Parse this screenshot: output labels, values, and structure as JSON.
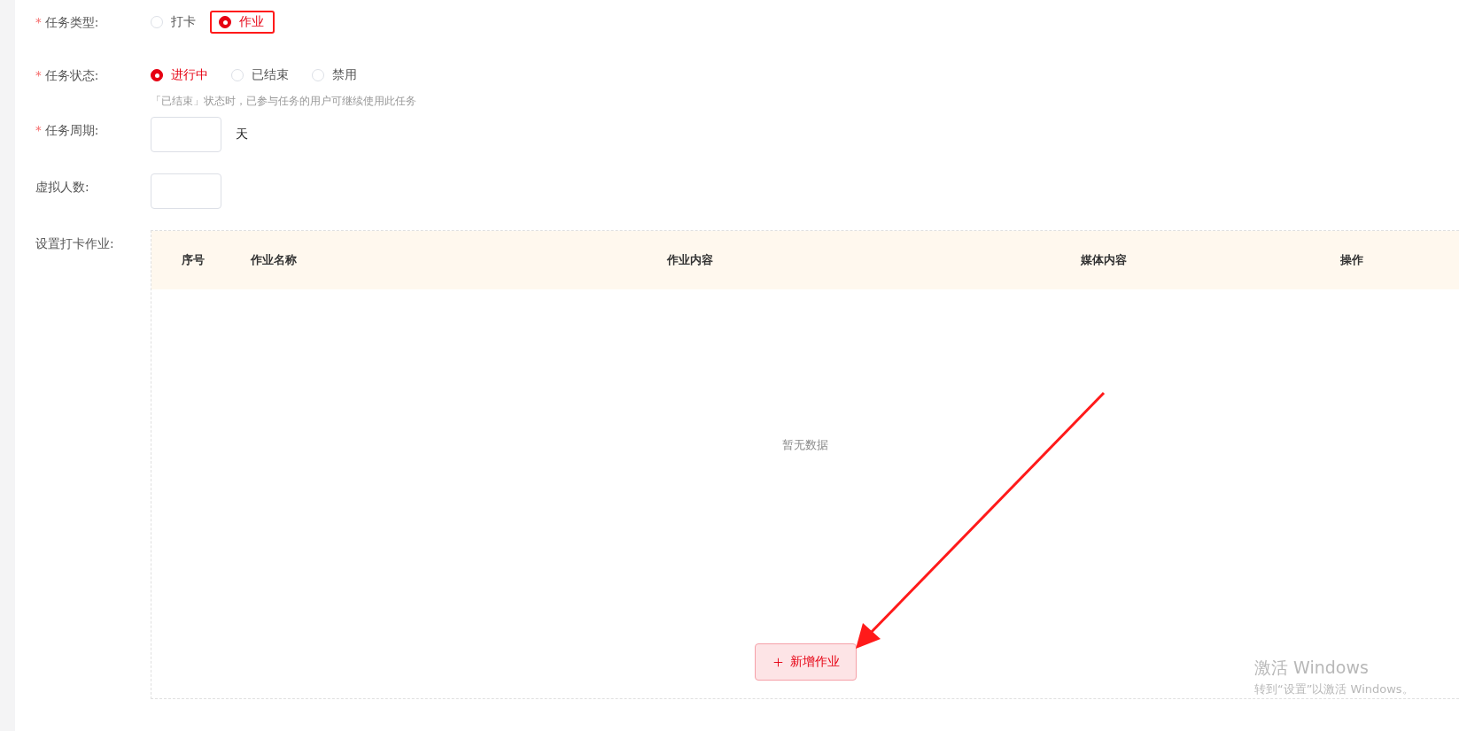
{
  "form": {
    "fields": [
      {
        "kind": "radio",
        "label": "任务类型:",
        "required_mark": "*",
        "options": [
          {
            "label": "打卡",
            "selected": false,
            "highlighted": false
          },
          {
            "label": "作业",
            "selected": true,
            "highlighted": true
          }
        ]
      },
      {
        "kind": "radio",
        "label": "任务状态:",
        "required_mark": "*",
        "options": [
          {
            "label": "进行中",
            "selected": true,
            "highlighted": false
          },
          {
            "label": "已结束",
            "selected": false,
            "highlighted": false
          },
          {
            "label": "禁用",
            "selected": false,
            "highlighted": false
          }
        ],
        "hint": "「已结束」状态时，已参与任务的用户可继续使用此任务"
      },
      {
        "kind": "number",
        "label": "任务周期:",
        "required_mark": "*",
        "unit": "天"
      },
      {
        "kind": "number",
        "label": "虚拟人数:"
      },
      {
        "kind": "table",
        "label": "设置打卡作业:",
        "columns": [
          "序号",
          "作业名称",
          "作业内容",
          "媒体内容",
          "操作"
        ],
        "empty_text": "暂无数据",
        "add_button": "新增作业"
      }
    ]
  },
  "annotation_arrow": true,
  "os_notice": {
    "title": "激活 Windows",
    "text": "转到“设置”以激活 Windows。"
  }
}
